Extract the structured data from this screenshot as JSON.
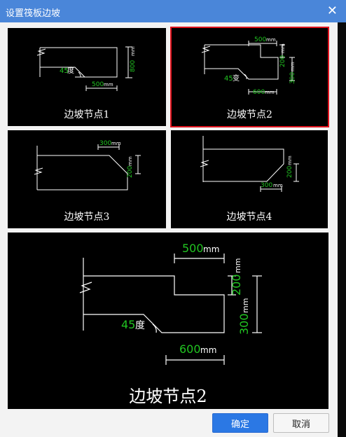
{
  "window": {
    "title": "设置筏板边坡"
  },
  "options": [
    {
      "label": "边坡节点1",
      "angle": "45",
      "angle_unit": "度",
      "width": "500",
      "width_unit": "mm",
      "height": "800",
      "height_unit": "mm"
    },
    {
      "label": "边坡节点2",
      "angle": "45",
      "angle_unit": "变",
      "top_width": "500",
      "top_width_unit": "mm",
      "bottom_width": "600",
      "bottom_width_unit": "mm",
      "height1": "200",
      "height1_unit": "mm",
      "height2": "300",
      "height2_unit": "mm"
    },
    {
      "label": "边坡节点3",
      "chamfer": "300",
      "chamfer_unit": "mm",
      "height": "200",
      "height_unit": "mm"
    },
    {
      "label": "边坡节点4",
      "chamfer": "300",
      "chamfer_unit": "mm",
      "height": "200",
      "height_unit": "mm"
    }
  ],
  "preview": {
    "label": "边坡节点2",
    "angle": "45",
    "angle_unit": "度",
    "top_width": "500",
    "top_width_unit": "mm",
    "bottom_width": "600",
    "bottom_width_unit": "mm",
    "height1": "200",
    "height1_unit": "mm",
    "height2": "300",
    "height2_unit": "mm"
  },
  "buttons": {
    "ok": "确定",
    "cancel": "取消"
  },
  "selected_option": 2
}
